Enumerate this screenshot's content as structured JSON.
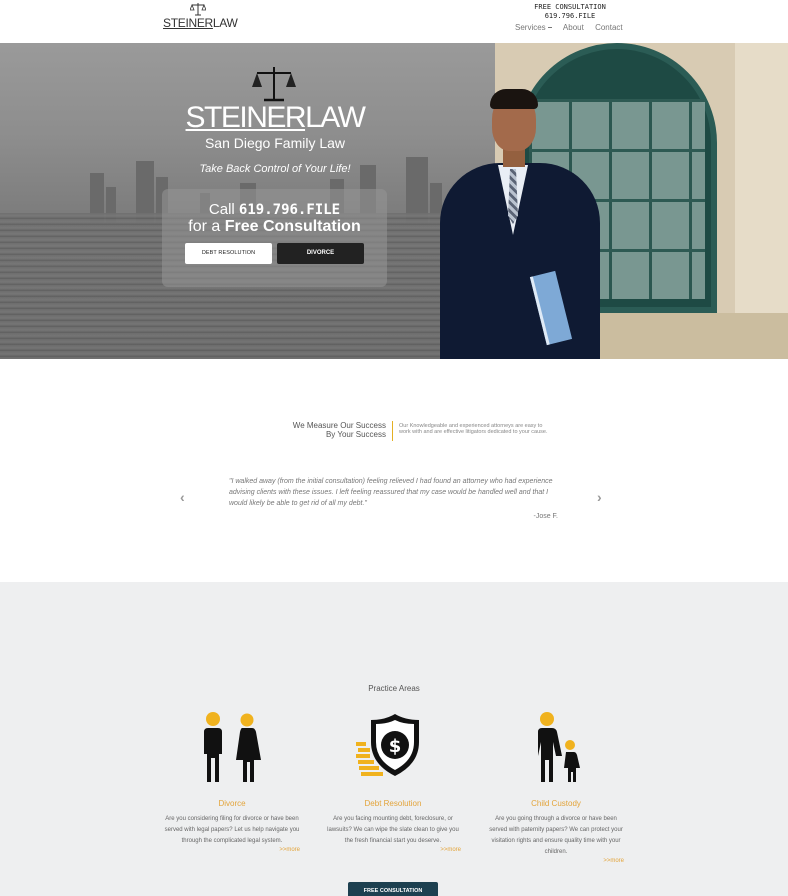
{
  "header": {
    "logo_text_a": "STEINER",
    "logo_text_b": "LAW",
    "phone_line1": "FREE CONSULTATION",
    "phone_line2": "619.796.FILE",
    "nav": [
      "Services",
      "About",
      "Contact"
    ]
  },
  "hero": {
    "logo_a": "STEINER",
    "logo_b": "LAW",
    "subtitle": "San Diego Family Law",
    "tagline": "Take Back Control of Your Life!",
    "call_prefix": "Call ",
    "call_number": "619.796.FILE",
    "consult_prefix": "for a ",
    "consult_bold": "Free Consultation",
    "btn_debt": "DEBT RESOLUTION",
    "btn_divorce": "DIVORCE"
  },
  "testimonial": {
    "heading_line1": "We Measure Our Success",
    "heading_line2": "By Your Success",
    "description": "Our Knowledgeable and experienced attorneys are easy to work with and are effective litigators dedicated to your cause.",
    "prev": "‹",
    "next": "›",
    "quote": "\"I walked away (from the initial consultation) feeling relieved I had found an attorney who had experience advising clients with these issues. I left feeling reassured that my case would be handled well and that I would likely be able to get rid of all my debt.\"",
    "author": "-Jose F."
  },
  "practice": {
    "title": "Practice Areas",
    "cards": [
      {
        "title": "Divorce",
        "desc": "Are you considering filing for divorce or have been served with legal papers? Let us help navigate you through the complicated legal system.",
        "more": ">>more"
      },
      {
        "title": "Debt Resolution",
        "desc": "Are you facing mounting debt, foreclosure, or lawsuits? We can wipe the slate clean to give you the fresh financial start you deserve.",
        "more": ">>more"
      },
      {
        "title": "Child Custody",
        "desc": "Are you going through a divorce or have been served with paternity papers? We can protect your visitation rights and ensure quality time with your children.",
        "more": ">>more"
      }
    ],
    "cta": "FREE CONSULTATION"
  },
  "colors": {
    "accent": "#e3a43a",
    "cta": "#1d4050",
    "divider": "#e4b024"
  }
}
